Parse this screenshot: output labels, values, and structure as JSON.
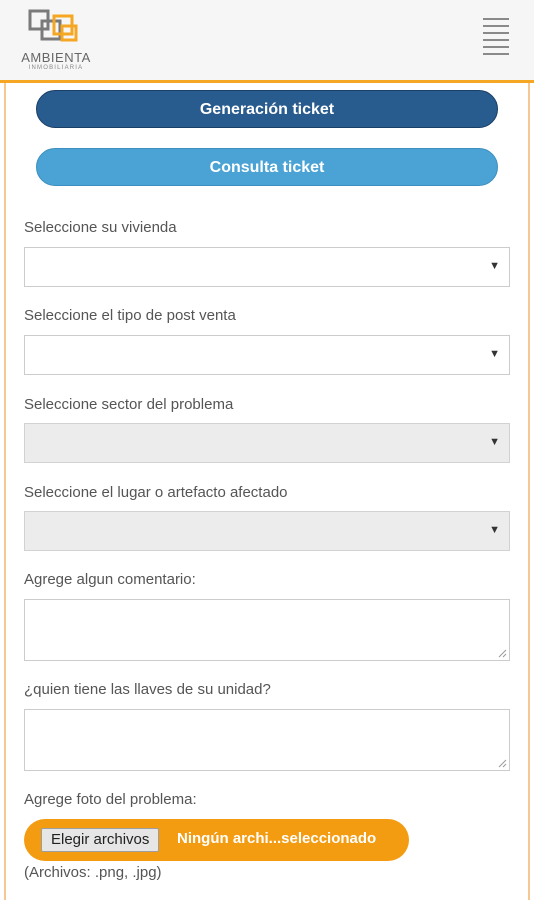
{
  "header": {
    "logo_text": "AMBIENTA",
    "logo_subtext": "INMOBILIARIA",
    "menu_icon": "hamburger-icon"
  },
  "actions": {
    "generate_ticket": "Generación ticket",
    "query_ticket": "Consulta ticket"
  },
  "form": {
    "housing": {
      "label": "Seleccione su vivienda",
      "value": ""
    },
    "post_sale_type": {
      "label": "Seleccione el tipo de post venta",
      "value": ""
    },
    "problem_sector": {
      "label": "Seleccione sector del problema",
      "value": ""
    },
    "affected_place": {
      "label": "Seleccione el lugar o artefacto afectado",
      "value": ""
    },
    "comment": {
      "label": "Agrege algun comentario:",
      "value": ""
    },
    "keys_holder": {
      "label": "¿quien tiene las llaves de su unidad?",
      "value": ""
    },
    "photo": {
      "label": "Agrege foto del problema:",
      "button": "Elegir archivos",
      "status": "Ningún archi...seleccionado",
      "hint": "(Archivos: .png, .jpg)"
    }
  },
  "colors": {
    "accent_orange": "#f39c12",
    "primary_dark_blue": "#285b8e",
    "primary_light_blue": "#4aa3d4"
  }
}
